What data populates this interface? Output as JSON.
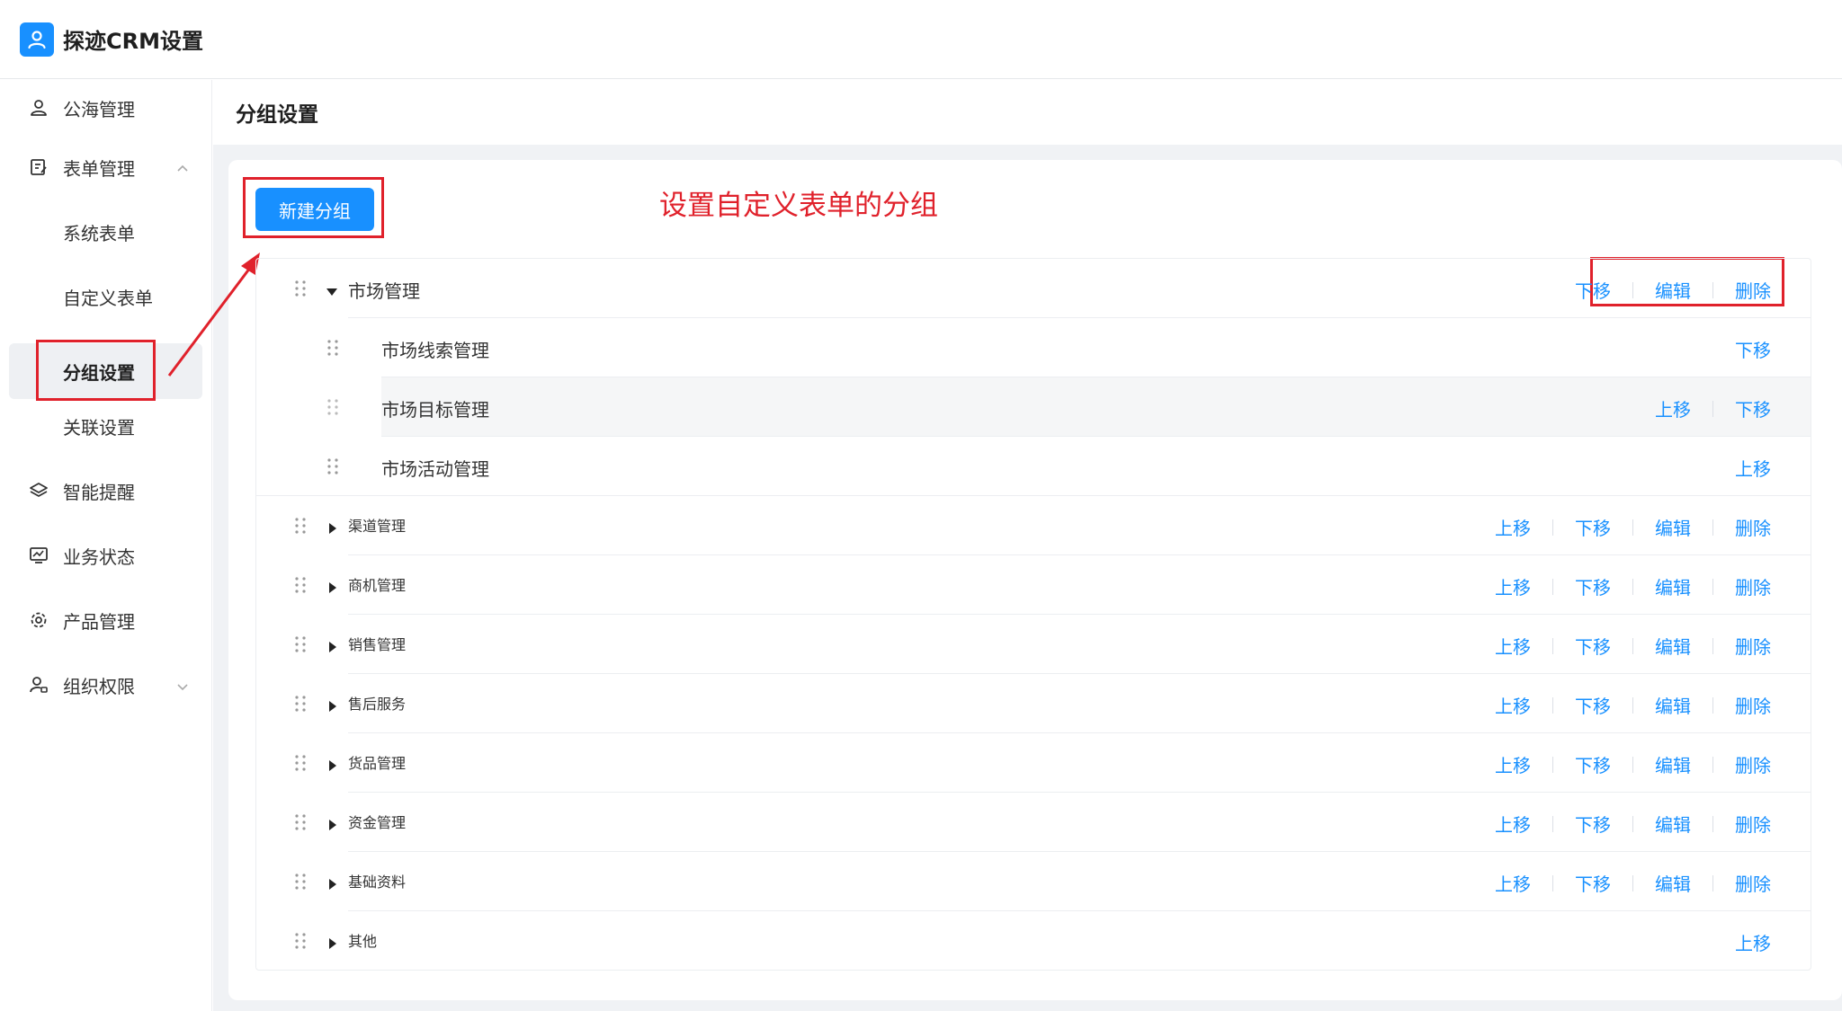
{
  "app": {
    "title": "探迹CRM设置",
    "accent": "#1890ff"
  },
  "sidebar": {
    "items": [
      {
        "label": "公海管理",
        "icon": "user-icon"
      },
      {
        "label": "表单管理",
        "icon": "form-edit-icon",
        "expanded": true
      },
      {
        "label": "系统表单",
        "sub": true
      },
      {
        "label": "自定义表单",
        "sub": true
      },
      {
        "label": "分组设置",
        "sub": true,
        "active": true
      },
      {
        "label": "关联设置",
        "sub": true
      },
      {
        "label": "智能提醒",
        "icon": "layers-icon"
      },
      {
        "label": "业务状态",
        "icon": "monitor-chart-icon"
      },
      {
        "label": "产品管理",
        "icon": "gear-icon"
      },
      {
        "label": "组织权限",
        "icon": "user-lock-icon",
        "expanded": false
      }
    ]
  },
  "page": {
    "title": "分组设置",
    "new_group_label": "新建分组"
  },
  "annotation": {
    "text": "设置自定义表单的分组",
    "color": "#e0212b"
  },
  "actions": {
    "up": "上移",
    "down": "下移",
    "edit": "编辑",
    "delete": "删除"
  },
  "groups": [
    {
      "label": "市场管理",
      "expanded": true,
      "actions": [
        "down",
        "edit",
        "delete"
      ],
      "children": [
        {
          "label": "市场线索管理",
          "actions": [
            "down"
          ]
        },
        {
          "label": "市场目标管理",
          "actions": [
            "up",
            "down"
          ],
          "hover": true
        },
        {
          "label": "市场活动管理",
          "actions": [
            "up"
          ]
        }
      ]
    },
    {
      "label": "渠道管理",
      "actions": [
        "up",
        "down",
        "edit",
        "delete"
      ]
    },
    {
      "label": "商机管理",
      "actions": [
        "up",
        "down",
        "edit",
        "delete"
      ]
    },
    {
      "label": "销售管理",
      "actions": [
        "up",
        "down",
        "edit",
        "delete"
      ]
    },
    {
      "label": "售后服务",
      "actions": [
        "up",
        "down",
        "edit",
        "delete"
      ]
    },
    {
      "label": "货品管理",
      "actions": [
        "up",
        "down",
        "edit",
        "delete"
      ]
    },
    {
      "label": "资金管理",
      "actions": [
        "up",
        "down",
        "edit",
        "delete"
      ]
    },
    {
      "label": "基础资料",
      "actions": [
        "up",
        "down",
        "edit",
        "delete"
      ]
    },
    {
      "label": "其他",
      "actions": [
        "up"
      ]
    }
  ]
}
